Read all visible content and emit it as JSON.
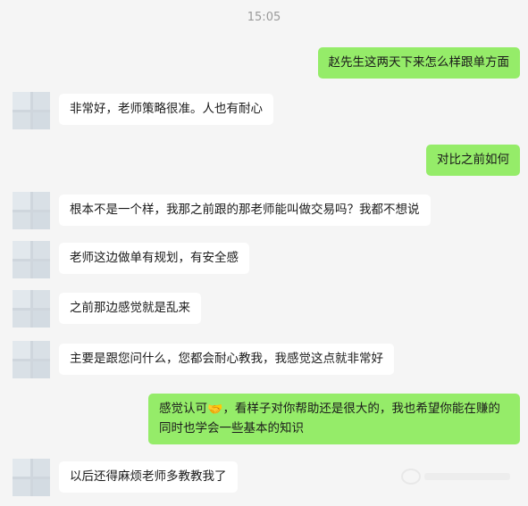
{
  "chat": {
    "timestamp": "15:05",
    "messages": [
      {
        "side": "right",
        "text": "赵先生这两天下来怎么样跟单方面"
      },
      {
        "side": "left",
        "text": "非常好，老师策略很准。人也有耐心"
      },
      {
        "side": "right",
        "text": "对比之前如何"
      },
      {
        "side": "left",
        "text": "根本不是一个样，我那之前跟的那老师能叫做交易吗？我都不想说"
      },
      {
        "side": "left",
        "text": "老师这边做单有规划，有安全感"
      },
      {
        "side": "left",
        "text": "之前那边感觉就是乱来"
      },
      {
        "side": "left",
        "text": "主要是跟您问什么，您都会耐心教我，我感觉这点就非常好"
      },
      {
        "side": "right",
        "text_before_emoji": "感觉认可",
        "emoji": "🤝",
        "text_after_emoji": "，看样子对你帮助还是很大的，我也希望你能在赚的同时也学会一些基本的知识"
      },
      {
        "side": "left",
        "text": "以后还得麻烦老师多教教我了"
      }
    ]
  },
  "icons": {
    "avatar": "default-avatar-icon",
    "emoji": "handshake-emoji-icon",
    "watermark": "watermark-logo-icon"
  },
  "colors": {
    "background": "#f5f5f5",
    "self_bubble": "#95ec69",
    "other_bubble": "#ffffff",
    "timestamp_text": "#9a9a9a"
  }
}
